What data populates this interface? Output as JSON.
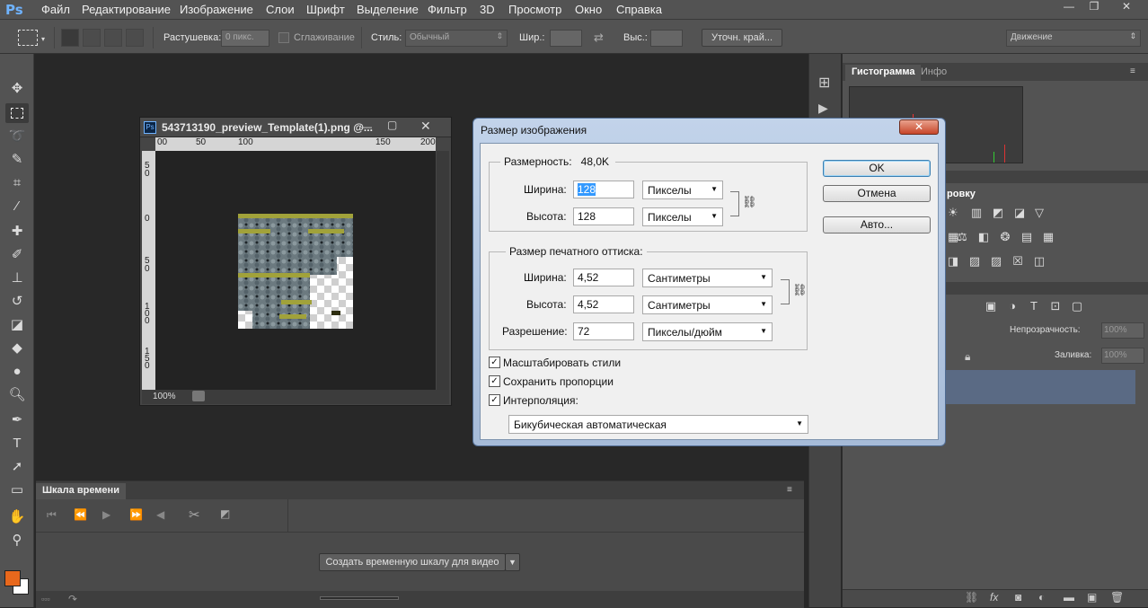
{
  "app": {
    "logo": "Ps"
  },
  "menubar": {
    "items": [
      "Файл",
      "Редактирование",
      "Изображение",
      "Слои",
      "Шрифт",
      "Выделение",
      "Фильтр",
      "3D",
      "Просмотр",
      "Окно",
      "Справка"
    ]
  },
  "window_controls": {
    "minimize": "—",
    "restore": "❐",
    "close": "✕"
  },
  "options_bar": {
    "feather_label": "Растушевка:",
    "feather_value": "0 пикс.",
    "antialias_label": "Сглаживание",
    "style_label": "Стиль:",
    "style_value": "Обычный",
    "width_label": "Шир.:",
    "height_label": "Выс.:",
    "refine_edge": "Уточн. край...",
    "workspace": "Движение"
  },
  "document": {
    "title": "543713190_preview_Template(1).png @...",
    "zoom": "100%",
    "ruler_top": [
      "00",
      "50",
      "100",
      "150",
      "200"
    ],
    "ruler_left": [
      "5 0",
      "0",
      "5 0",
      "1 0 0",
      "1 5 0"
    ]
  },
  "timeline": {
    "tab": "Шкала времени",
    "create_button": "Создать временную шкалу для видео"
  },
  "panels": {
    "tabs": [
      "Гистограмма",
      "Инфо"
    ],
    "adjustments_partial": "ровку",
    "opacity_label": "Непрозрачность:",
    "opacity_value": "100%",
    "fill_label": "Заливка:",
    "fill_value": "100%"
  },
  "dialog": {
    "title": "Размер изображения",
    "close": "✕",
    "pixel_dims_label": "Размерность:",
    "pixel_dims_value": "48,0K",
    "width_label": "Ширина:",
    "height_label": "Высота:",
    "px_width": "128",
    "px_height": "128",
    "px_unit": "Пикселы",
    "print_size_label": "Размер печатного оттиска:",
    "doc_width": "4,52",
    "doc_height": "4,52",
    "doc_unit": "Сантиметры",
    "resolution_label": "Разрешение:",
    "resolution": "72",
    "resolution_unit": "Пикселы/дюйм",
    "scale_styles": "Масштабировать стили",
    "constrain": "Сохранить пропорции",
    "resample": "Интерполяция:",
    "resample_method": "Бикубическая автоматическая",
    "ok": "OK",
    "cancel": "Отмена",
    "auto": "Авто...",
    "check_mark": "✓"
  }
}
